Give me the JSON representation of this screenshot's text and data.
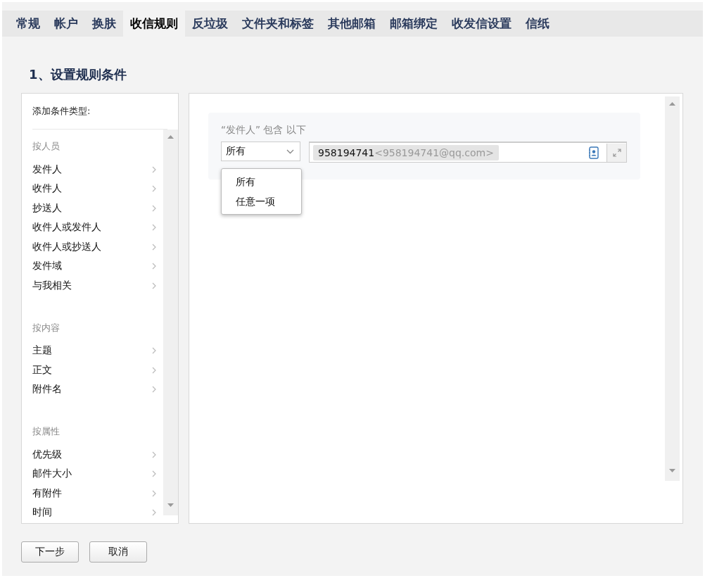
{
  "tabs": [
    {
      "label": "常规",
      "selected": false
    },
    {
      "label": "帐户",
      "selected": false
    },
    {
      "label": "换肤",
      "selected": false
    },
    {
      "label": "收信规则",
      "selected": true
    },
    {
      "label": "反垃圾",
      "selected": false
    },
    {
      "label": "文件夹和标签",
      "selected": false
    },
    {
      "label": "其他邮箱",
      "selected": false
    },
    {
      "label": "邮箱绑定",
      "selected": false
    },
    {
      "label": "收发信设置",
      "selected": false
    },
    {
      "label": "信纸",
      "selected": false
    }
  ],
  "heading": "1、设置规则条件",
  "condition_types": {
    "title": "添加条件类型:",
    "groups": [
      {
        "title": "按人员",
        "items": [
          "发件人",
          "收件人",
          "抄送人",
          "收件人或发件人",
          "收件人或抄送人",
          "发件域",
          "与我相关"
        ]
      },
      {
        "title": "按内容",
        "items": [
          "主题",
          "正文",
          "附件名"
        ]
      },
      {
        "title": "按属性",
        "items": [
          "优先级",
          "邮件大小",
          "有附件",
          "时间"
        ]
      }
    ]
  },
  "condition": {
    "label": "“发件人” 包含 以下",
    "match": "所有",
    "match_options": [
      "所有",
      "任意一项"
    ],
    "recipients": [
      {
        "name": "958194741",
        "address": "<958194741@qq.com>"
      }
    ]
  },
  "buttons": [
    "下一步",
    "取消"
  ]
}
